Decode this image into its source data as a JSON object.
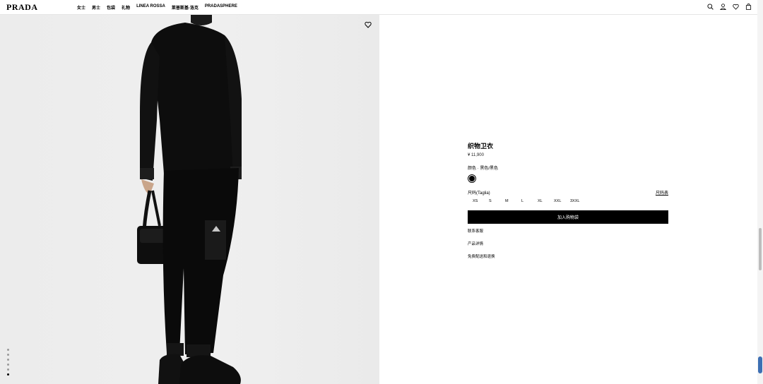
{
  "brand": "PRADA",
  "nav": [
    "女士",
    "男士",
    "包袋",
    "礼物",
    "LINEA ROSSA",
    "莱普斯基·洛克",
    "PRADASPHERE"
  ],
  "header_icons": [
    "search-icon",
    "account-icon",
    "wishlist-icon",
    "bag-icon"
  ],
  "product": {
    "title": "织物卫衣",
    "price": "¥ 11,900",
    "color_label": "颜色 · 黑色/黑色",
    "selected_color": "#000000",
    "size_label": "尺码(Taglia)",
    "size_guide": "尺码表",
    "sizes": [
      "XS",
      "S",
      "M",
      "L",
      "XL",
      "XXL",
      "3XXL"
    ],
    "add_to_cart": "加入购物袋",
    "links": [
      "联系客服",
      "产品详情",
      "免费配送和退换"
    ]
  },
  "gallery": {
    "image_count": 6,
    "active_index": 5
  }
}
